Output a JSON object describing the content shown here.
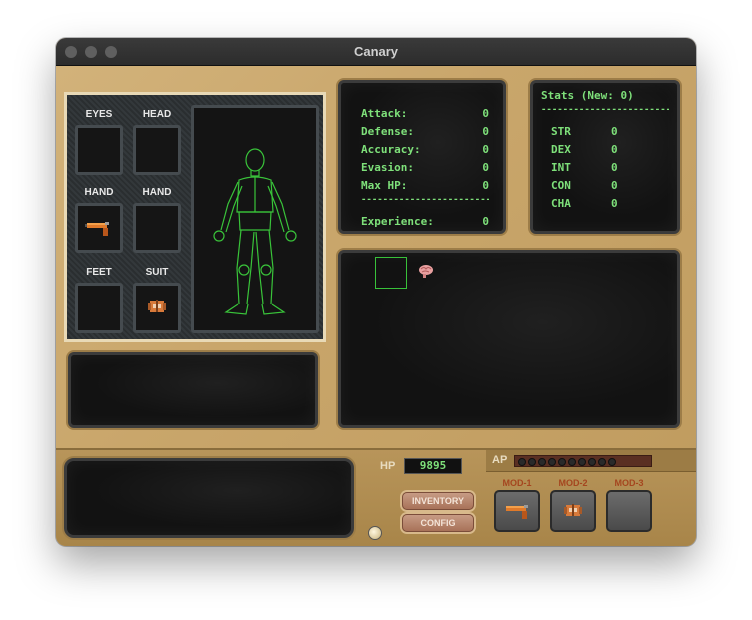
{
  "window": {
    "title": "Canary"
  },
  "equipment": {
    "slots": [
      {
        "label": "EYES"
      },
      {
        "label": "HEAD"
      },
      {
        "label": "HAND",
        "item": "pistol-icon"
      },
      {
        "label": "HAND"
      },
      {
        "label": "FEET"
      },
      {
        "label": "SUIT",
        "item": "suit-icon"
      }
    ]
  },
  "combat_stats": {
    "rows": [
      {
        "label": "Attack:",
        "value": "0"
      },
      {
        "label": "Defense:",
        "value": "0"
      },
      {
        "label": "Accuracy:",
        "value": "0"
      },
      {
        "label": "Evasion:",
        "value": "0"
      },
      {
        "label": "Max HP:",
        "value": "0"
      }
    ],
    "divider": "-------------------------",
    "experience_label": "Experience:",
    "experience_value": "0"
  },
  "abilities": {
    "title": "Stats",
    "new_label": "(New:",
    "new_value": "0)",
    "divider": "-------------------------",
    "rows": [
      {
        "label": "STR",
        "value": "0"
      },
      {
        "label": "DEX",
        "value": "0"
      },
      {
        "label": "INT",
        "value": "0"
      },
      {
        "label": "CON",
        "value": "0"
      },
      {
        "label": "CHA",
        "value": "0"
      }
    ]
  },
  "inventory": {
    "items": [
      "brain-icon"
    ]
  },
  "hud": {
    "hp_label": "HP",
    "hp_value": "9895",
    "ap_label": "AP",
    "ap_pips": 10,
    "inventory_button": "INVENTORY",
    "config_button": "CONFIG",
    "mods": [
      {
        "label": "MOD-1",
        "item": "pistol-icon"
      },
      {
        "label": "MOD-2",
        "item": "suit-icon"
      },
      {
        "label": "MOD-3"
      }
    ]
  },
  "colors": {
    "terminal_green": "#7ee07a",
    "panel_tan": "#c9a66b",
    "mod_label": "#a5461f"
  }
}
